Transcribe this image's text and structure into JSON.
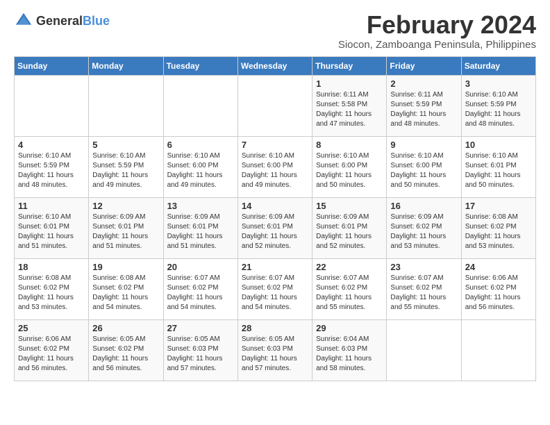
{
  "logo": {
    "text_general": "General",
    "text_blue": "Blue"
  },
  "title": {
    "month_year": "February 2024",
    "location": "Siocon, Zamboanga Peninsula, Philippines"
  },
  "days_of_week": [
    "Sunday",
    "Monday",
    "Tuesday",
    "Wednesday",
    "Thursday",
    "Friday",
    "Saturday"
  ],
  "weeks": [
    [
      {
        "day": "",
        "info": ""
      },
      {
        "day": "",
        "info": ""
      },
      {
        "day": "",
        "info": ""
      },
      {
        "day": "",
        "info": ""
      },
      {
        "day": "1",
        "info": "Sunrise: 6:11 AM\nSunset: 5:58 PM\nDaylight: 11 hours\nand 47 minutes."
      },
      {
        "day": "2",
        "info": "Sunrise: 6:11 AM\nSunset: 5:59 PM\nDaylight: 11 hours\nand 48 minutes."
      },
      {
        "day": "3",
        "info": "Sunrise: 6:10 AM\nSunset: 5:59 PM\nDaylight: 11 hours\nand 48 minutes."
      }
    ],
    [
      {
        "day": "4",
        "info": "Sunrise: 6:10 AM\nSunset: 5:59 PM\nDaylight: 11 hours\nand 48 minutes."
      },
      {
        "day": "5",
        "info": "Sunrise: 6:10 AM\nSunset: 5:59 PM\nDaylight: 11 hours\nand 49 minutes."
      },
      {
        "day": "6",
        "info": "Sunrise: 6:10 AM\nSunset: 6:00 PM\nDaylight: 11 hours\nand 49 minutes."
      },
      {
        "day": "7",
        "info": "Sunrise: 6:10 AM\nSunset: 6:00 PM\nDaylight: 11 hours\nand 49 minutes."
      },
      {
        "day": "8",
        "info": "Sunrise: 6:10 AM\nSunset: 6:00 PM\nDaylight: 11 hours\nand 50 minutes."
      },
      {
        "day": "9",
        "info": "Sunrise: 6:10 AM\nSunset: 6:00 PM\nDaylight: 11 hours\nand 50 minutes."
      },
      {
        "day": "10",
        "info": "Sunrise: 6:10 AM\nSunset: 6:01 PM\nDaylight: 11 hours\nand 50 minutes."
      }
    ],
    [
      {
        "day": "11",
        "info": "Sunrise: 6:10 AM\nSunset: 6:01 PM\nDaylight: 11 hours\nand 51 minutes."
      },
      {
        "day": "12",
        "info": "Sunrise: 6:09 AM\nSunset: 6:01 PM\nDaylight: 11 hours\nand 51 minutes."
      },
      {
        "day": "13",
        "info": "Sunrise: 6:09 AM\nSunset: 6:01 PM\nDaylight: 11 hours\nand 51 minutes."
      },
      {
        "day": "14",
        "info": "Sunrise: 6:09 AM\nSunset: 6:01 PM\nDaylight: 11 hours\nand 52 minutes."
      },
      {
        "day": "15",
        "info": "Sunrise: 6:09 AM\nSunset: 6:01 PM\nDaylight: 11 hours\nand 52 minutes."
      },
      {
        "day": "16",
        "info": "Sunrise: 6:09 AM\nSunset: 6:02 PM\nDaylight: 11 hours\nand 53 minutes."
      },
      {
        "day": "17",
        "info": "Sunrise: 6:08 AM\nSunset: 6:02 PM\nDaylight: 11 hours\nand 53 minutes."
      }
    ],
    [
      {
        "day": "18",
        "info": "Sunrise: 6:08 AM\nSunset: 6:02 PM\nDaylight: 11 hours\nand 53 minutes."
      },
      {
        "day": "19",
        "info": "Sunrise: 6:08 AM\nSunset: 6:02 PM\nDaylight: 11 hours\nand 54 minutes."
      },
      {
        "day": "20",
        "info": "Sunrise: 6:07 AM\nSunset: 6:02 PM\nDaylight: 11 hours\nand 54 minutes."
      },
      {
        "day": "21",
        "info": "Sunrise: 6:07 AM\nSunset: 6:02 PM\nDaylight: 11 hours\nand 54 minutes."
      },
      {
        "day": "22",
        "info": "Sunrise: 6:07 AM\nSunset: 6:02 PM\nDaylight: 11 hours\nand 55 minutes."
      },
      {
        "day": "23",
        "info": "Sunrise: 6:07 AM\nSunset: 6:02 PM\nDaylight: 11 hours\nand 55 minutes."
      },
      {
        "day": "24",
        "info": "Sunrise: 6:06 AM\nSunset: 6:02 PM\nDaylight: 11 hours\nand 56 minutes."
      }
    ],
    [
      {
        "day": "25",
        "info": "Sunrise: 6:06 AM\nSunset: 6:02 PM\nDaylight: 11 hours\nand 56 minutes."
      },
      {
        "day": "26",
        "info": "Sunrise: 6:05 AM\nSunset: 6:02 PM\nDaylight: 11 hours\nand 56 minutes."
      },
      {
        "day": "27",
        "info": "Sunrise: 6:05 AM\nSunset: 6:03 PM\nDaylight: 11 hours\nand 57 minutes."
      },
      {
        "day": "28",
        "info": "Sunrise: 6:05 AM\nSunset: 6:03 PM\nDaylight: 11 hours\nand 57 minutes."
      },
      {
        "day": "29",
        "info": "Sunrise: 6:04 AM\nSunset: 6:03 PM\nDaylight: 11 hours\nand 58 minutes."
      },
      {
        "day": "",
        "info": ""
      },
      {
        "day": "",
        "info": ""
      }
    ]
  ]
}
